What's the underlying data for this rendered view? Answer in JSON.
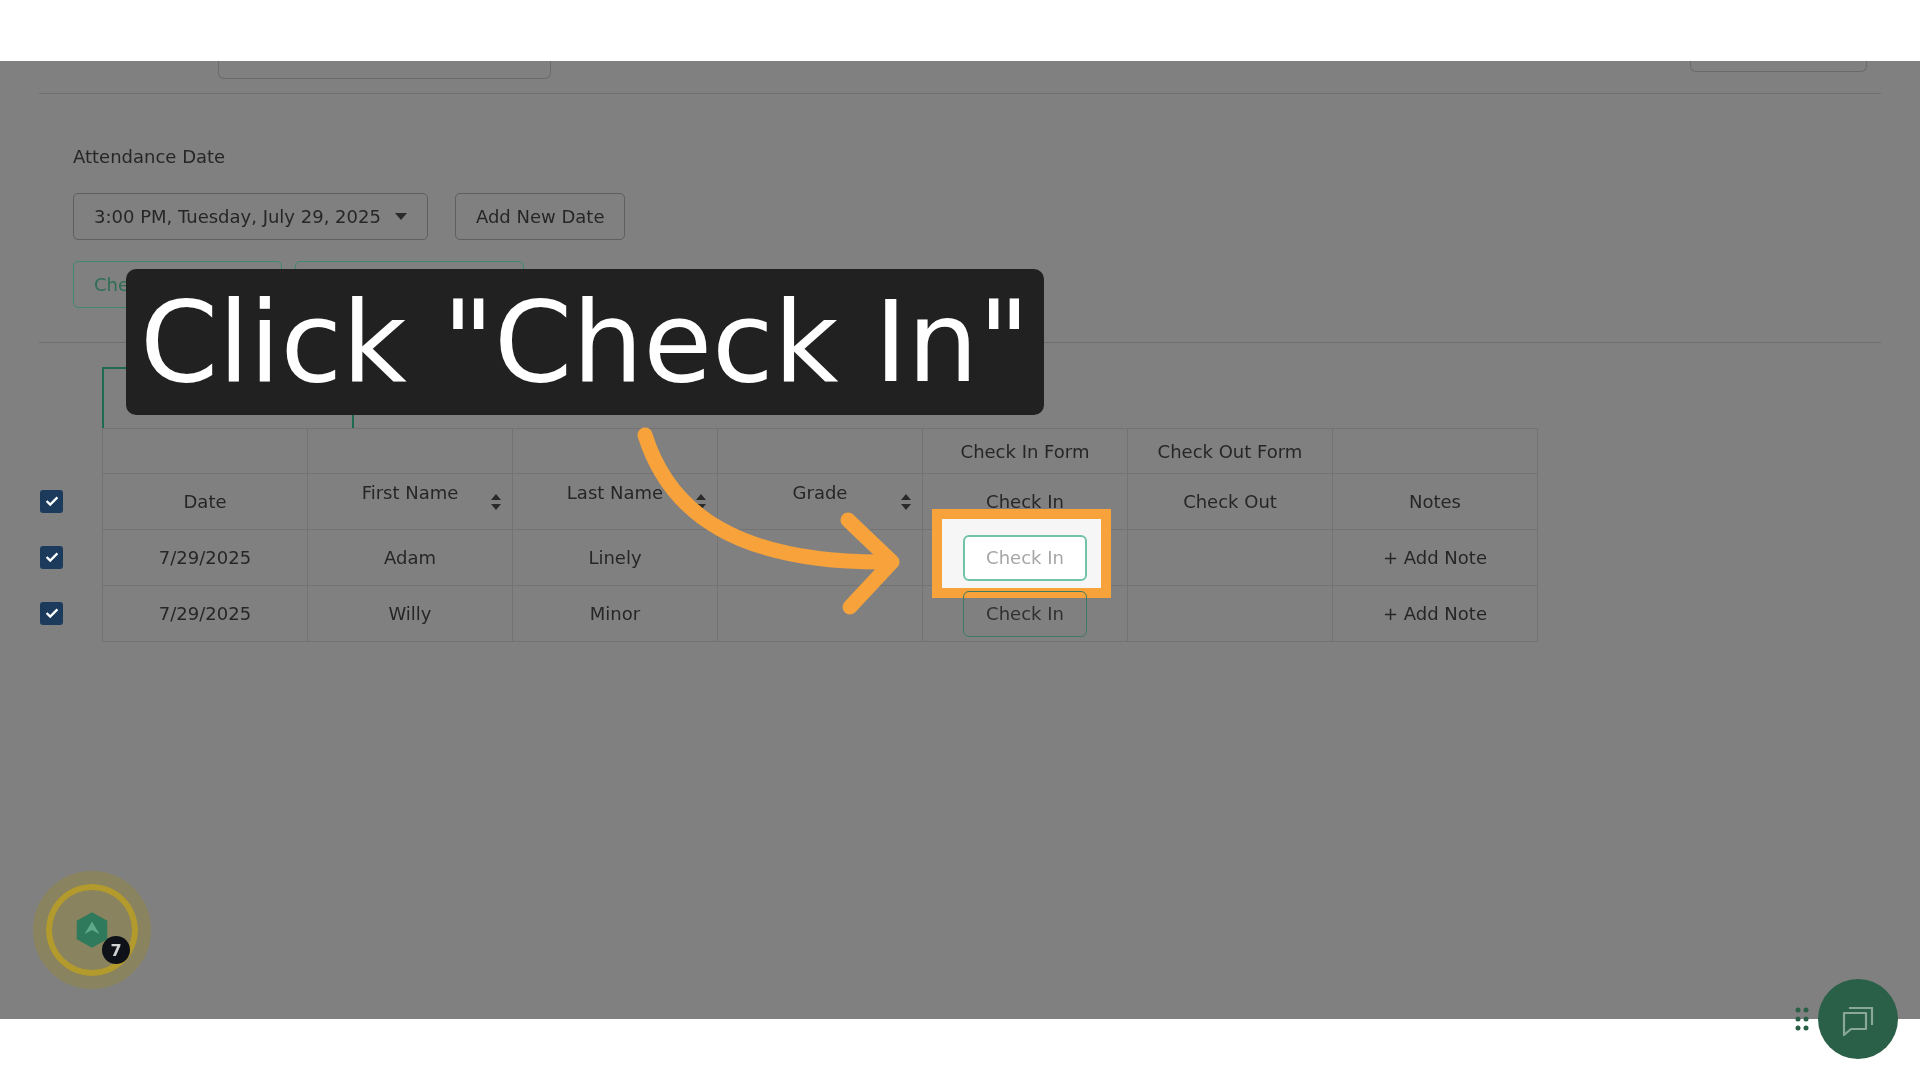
{
  "attendance": {
    "label": "Attendance Date",
    "date_select": "3:00 PM, Tuesday, July 29, 2025",
    "add_button": "Add New Date",
    "bulk_buttons": [
      "Che"
    ]
  },
  "table": {
    "select_all_checked": true,
    "columns": [
      {
        "label": "Date",
        "sortable": false
      },
      {
        "label": "First Name",
        "sortable": true
      },
      {
        "label": "Last Name",
        "sortable": true
      },
      {
        "label": "Grade",
        "sortable": true
      },
      {
        "label": "Check In",
        "sortable": false,
        "group": "Check In Form"
      },
      {
        "label": "Check Out",
        "sortable": false,
        "group": "Check Out Form"
      },
      {
        "label": "Notes",
        "sortable": false
      }
    ],
    "rows": [
      {
        "checked": true,
        "date": "7/29/2025",
        "first_name": "Adam",
        "last_name": "Linely",
        "check_in_button": "Check In",
        "highlighted": true,
        "notes": "+ Add Note"
      },
      {
        "checked": true,
        "date": "7/29/2025",
        "first_name": "Willy",
        "last_name": "Minor",
        "check_in_button": "Check In",
        "highlighted": false,
        "notes": "+ Add Note"
      }
    ]
  },
  "callout": {
    "text": "Click \"Check In\""
  },
  "help_widget": {
    "badge": "7"
  }
}
